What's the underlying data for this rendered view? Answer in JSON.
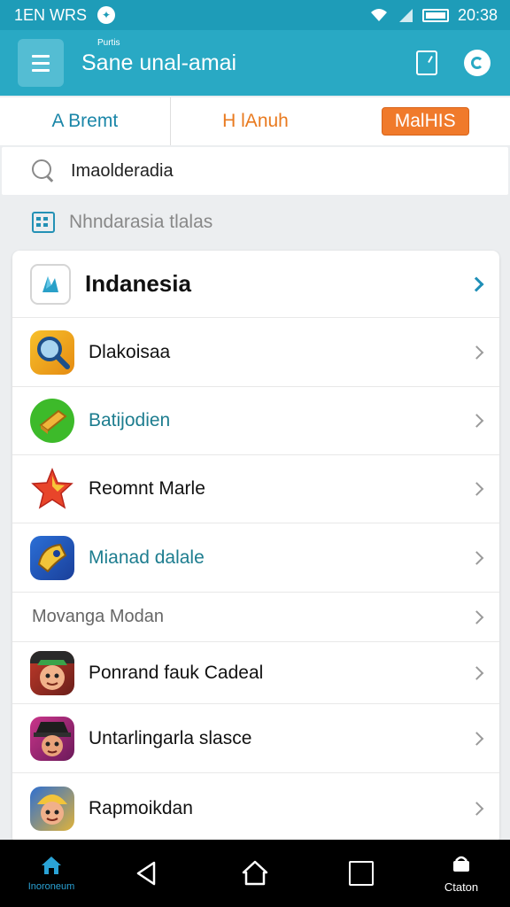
{
  "status_bar": {
    "left_text": "1EN WRS",
    "time": "20:38",
    "left_icon": "notification-icon",
    "icons": [
      "wifi-icon",
      "signal-icon",
      "battery-icon"
    ]
  },
  "app_bar": {
    "small_text": "Purtis",
    "title": "Sane unal-amai",
    "icons": [
      "menu-icon",
      "document-icon",
      "refresh-icon"
    ]
  },
  "tabs": [
    {
      "label": "A Bremt"
    },
    {
      "label": "H lAnuh"
    },
    {
      "label": "MalHIS",
      "selected": true
    }
  ],
  "search": {
    "value": "Imaolderadia",
    "icon": "search-icon"
  },
  "section": {
    "title": "Nhndarasia tlalas",
    "icon": "calendar-icon"
  },
  "list": {
    "header": {
      "label": "Indanesia",
      "icon": "app-logo-icon"
    },
    "items": [
      {
        "label": "Dlakoisaa",
        "icon": "magnifier-game-icon"
      },
      {
        "label": "Batijodien",
        "icon": "gold-bar-icon"
      },
      {
        "label": "Reomnt Marle",
        "icon": "star-icon"
      },
      {
        "label": "Mianad dalale",
        "icon": "horn-game-icon"
      }
    ],
    "subheader": {
      "label": "Movanga Modan"
    },
    "items2": [
      {
        "label": "Ponrand fauk Cadeal",
        "icon": "character-icon"
      },
      {
        "label": "Untarlingarla slasce",
        "icon": "character-hat-icon"
      },
      {
        "label": "Rapmoikdan",
        "icon": "character-blue-icon"
      }
    ]
  },
  "nav_bar": {
    "home_label": "Inoroneum",
    "cart_label": "Ctaton",
    "icons": [
      "home-icon",
      "back-icon",
      "home-button-icon",
      "recent-apps-icon",
      "cart-icon"
    ]
  },
  "colors": {
    "primary": "#29a9c4",
    "accent": "#f07a2b",
    "teal_text": "#1d7d8f"
  }
}
